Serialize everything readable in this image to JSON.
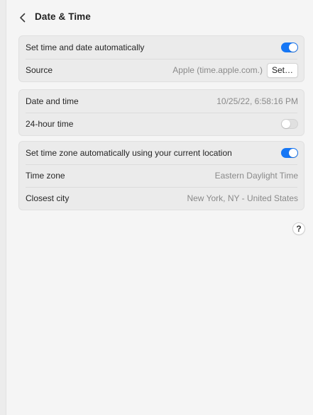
{
  "header": {
    "title": "Date & Time"
  },
  "automatic": {
    "set_auto_label": "Set time and date automatically",
    "set_auto_on": true,
    "source_label": "Source",
    "source_value": "Apple (time.apple.com.)",
    "set_button_label": "Set…"
  },
  "datetime": {
    "date_time_label": "Date and time",
    "date_time_value": "10/25/22, 6:58:16 PM",
    "hour24_label": "24-hour time",
    "hour24_on": false
  },
  "timezone": {
    "auto_tz_label": "Set time zone automatically using your current location",
    "auto_tz_on": true,
    "time_zone_label": "Time zone",
    "time_zone_value": "Eastern Daylight Time",
    "closest_city_label": "Closest city",
    "closest_city_value": "New York, NY - United States"
  },
  "help": {
    "label": "?"
  },
  "colors": {
    "accent": "#1677f5",
    "window_bg": "#f5f5f5",
    "group_bg": "#ebebeb"
  }
}
